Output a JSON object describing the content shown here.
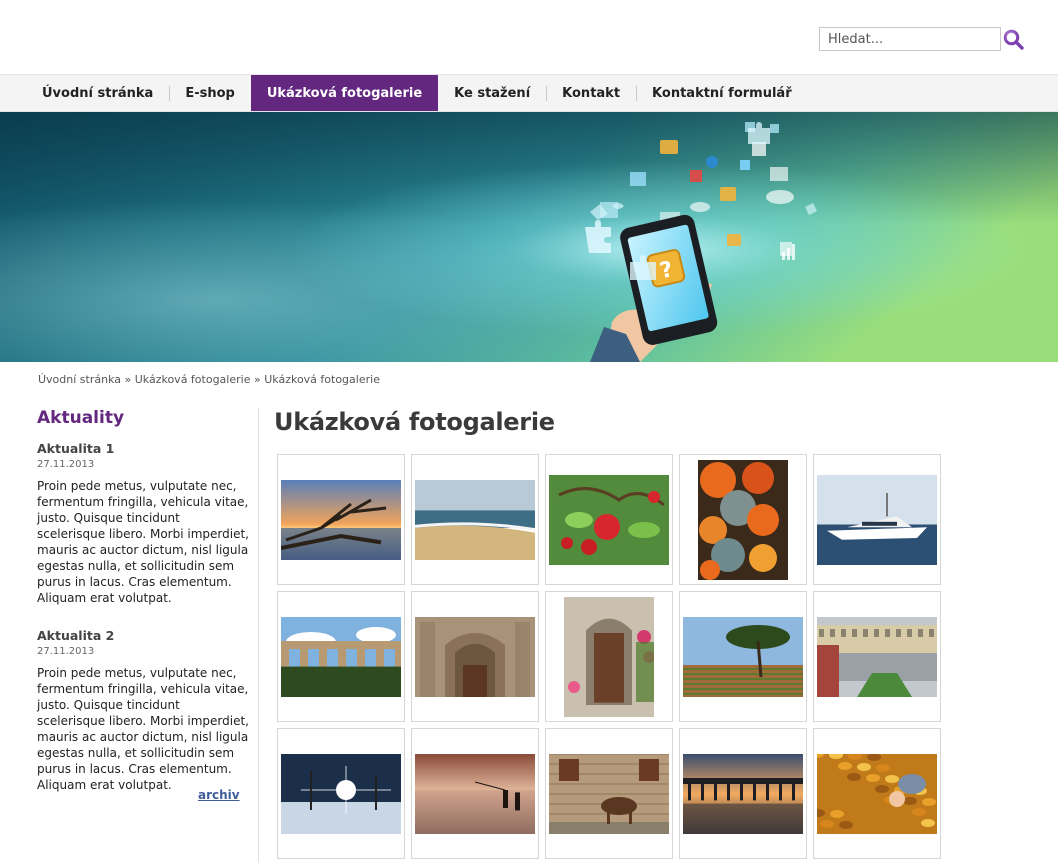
{
  "search": {
    "placeholder": "Hledat..."
  },
  "nav": {
    "items": [
      {
        "label": "Úvodní stránka"
      },
      {
        "label": "E-shop"
      },
      {
        "label": "Ukázková fotogalerie",
        "active": true
      },
      {
        "label": "Ke stažení"
      },
      {
        "label": "Kontakt"
      },
      {
        "label": "Kontaktní formulář"
      }
    ]
  },
  "breadcrumb": {
    "home": "Úvodní stránka",
    "sep1": " » ",
    "level1": "Ukázková fotogalerie",
    "sep2": " » ",
    "current": "Ukázková fotogalerie"
  },
  "sidebar": {
    "title": "Aktuality",
    "news": [
      {
        "title": "Aktualita 1",
        "date": "27.11.2013",
        "text": "Proin pede metus, vulputate nec, fermentum fringilla, vehicula vitae, justo. Quisque tincidunt scelerisque libero. Morbi imperdiet, mauris ac auctor dictum, nisl ligula egestas nulla, et sollicitudin sem purus in lacus. Cras elementum. Aliquam erat volutpat."
      },
      {
        "title": "Aktualita 2",
        "date": "27.11.2013",
        "text": "Proin pede metus, vulputate nec, fermentum fringilla, vehicula vitae, justo. Quisque tincidunt scelerisque libero. Morbi imperdiet, mauris ac auctor dictum, nisl ligula egestas nulla, et sollicitudin sem purus in lacus. Cras elementum. Aliquam erat volutpat."
      }
    ],
    "archive_label": "archiv"
  },
  "main": {
    "title": "Ukázková fotogalerie"
  },
  "gallery": [
    {
      "name": "driftwood-beach-sunset-photo",
      "subject": "driftwood",
      "orientation": "landscape"
    },
    {
      "name": "sandy-beach-waves-photo",
      "subject": "beach",
      "orientation": "landscape"
    },
    {
      "name": "red-apples-tree-photo",
      "subject": "apples",
      "orientation": "landscape"
    },
    {
      "name": "pumpkins-pile-photo",
      "subject": "pumpkins",
      "orientation": "portrait"
    },
    {
      "name": "luxury-yacht-harbor-photo",
      "subject": "yacht",
      "orientation": "landscape"
    },
    {
      "name": "roman-aqueduct-photo",
      "subject": "aqueduct",
      "orientation": "landscape"
    },
    {
      "name": "church-portal-photo",
      "subject": "church",
      "orientation": "landscape"
    },
    {
      "name": "stone-doorway-flowers-photo",
      "subject": "doorway",
      "orientation": "portrait"
    },
    {
      "name": "umbrella-pine-vineyard-photo",
      "subject": "pine",
      "orientation": "landscape"
    },
    {
      "name": "city-square-aerial-photo",
      "subject": "city",
      "orientation": "landscape"
    },
    {
      "name": "winter-sunburst-power-lines-photo",
      "subject": "winter",
      "orientation": "landscape"
    },
    {
      "name": "fishermen-misty-lake-photo",
      "subject": "fishermen",
      "orientation": "landscape"
    },
    {
      "name": "horse-stone-wall-photo",
      "subject": "horse",
      "orientation": "landscape"
    },
    {
      "name": "pier-sunset-photo",
      "subject": "pier",
      "orientation": "landscape"
    },
    {
      "name": "child-autumn-leaves-photo",
      "subject": "leaves",
      "orientation": "landscape"
    }
  ],
  "colors": {
    "accent": "#63277f",
    "link": "#3f5d9a",
    "nav_bg": "#f4f4f4"
  }
}
